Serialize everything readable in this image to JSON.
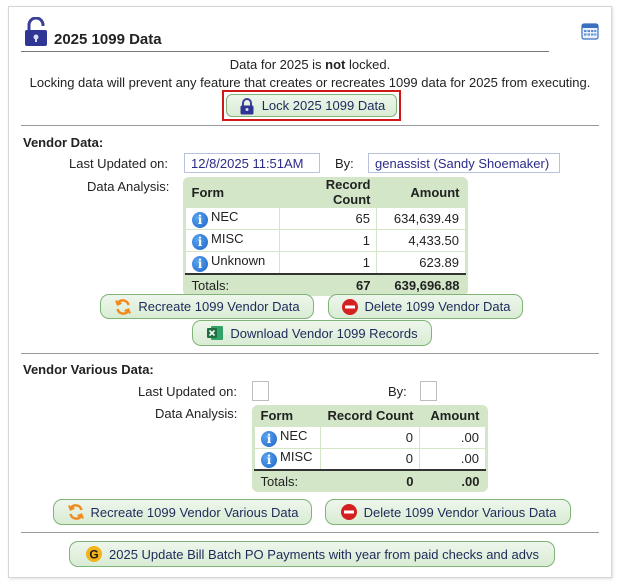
{
  "header": {
    "title": "2025 1099 Data",
    "calendar_icon": "calendar-icon",
    "lock_icon": "padlock-open-icon"
  },
  "lock_status": {
    "line1_pre": "Data for 2025 is ",
    "line1_bold": "not",
    "line1_post": " locked.",
    "line2": "Locking data will prevent any feature that creates or recreates 1099 data for 2025 from executing.",
    "lock_button": "Lock 2025 1099 Data"
  },
  "vendor": {
    "section_title": "Vendor Data:",
    "last_updated_label": "Last Updated on:",
    "last_updated_value": "12/8/2025 11:51AM",
    "by_label": "By:",
    "by_value": "genassist (Sandy Shoemaker)",
    "analysis_label": "Data Analysis:",
    "columns": [
      "Form",
      "Record Count",
      "Amount"
    ],
    "rows": [
      {
        "form": "NEC",
        "count": "65",
        "amount": "634,639.49"
      },
      {
        "form": "MISC",
        "count": "1",
        "amount": "4,433.50"
      },
      {
        "form": "Unknown",
        "count": "1",
        "amount": "623.89"
      }
    ],
    "totals": {
      "label": "Totals:",
      "count": "67",
      "amount": "639,696.88"
    },
    "recreate_button": "Recreate 1099 Vendor Data",
    "delete_button": "Delete 1099 Vendor Data",
    "download_button": "Download Vendor 1099 Records"
  },
  "various": {
    "section_title": "Vendor Various Data:",
    "last_updated_label": "Last Updated on:",
    "by_label": "By:",
    "analysis_label": "Data Analysis:",
    "columns": [
      "Form",
      "Record Count",
      "Amount"
    ],
    "rows": [
      {
        "form": "NEC",
        "count": "0",
        "amount": ".00"
      },
      {
        "form": "MISC",
        "count": "0",
        "amount": ".00"
      }
    ],
    "totals": {
      "label": "Totals:",
      "count": "0",
      "amount": ".00"
    },
    "recreate_button": "Recreate 1099 Vendor Various Data",
    "delete_button": "Delete 1099 Vendor Various Data"
  },
  "update_button": "2025 Update Bill Batch PO Payments with year from paid checks and advs",
  "colors": {
    "button_bg": "#d9ecd4",
    "button_border": "#7fb476",
    "grid_bg": "#d3e6c8",
    "highlight": "#d01818",
    "value_text": "#2b2b8a"
  }
}
